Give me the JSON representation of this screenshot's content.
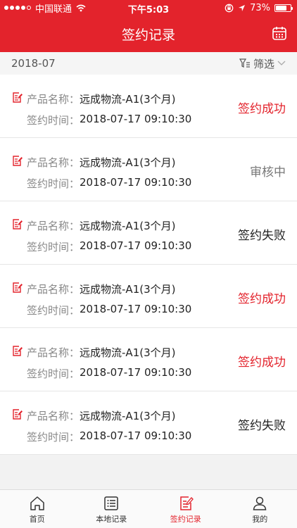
{
  "status_bar": {
    "carrier": "中国联通",
    "time": "下午5:03",
    "battery": "73%",
    "battery_level": 0.73
  },
  "header": {
    "title": "签约记录",
    "calendar_icon": "calendar-icon"
  },
  "filter_bar": {
    "month": "2018-07",
    "filter_label": "筛选"
  },
  "colors": {
    "accent": "#e3232c"
  },
  "records": [
    {
      "name_label": "产品名称：",
      "name": "远成物流-A1(3个月)",
      "time_label": "签约时间：",
      "time": "2018-07-17   09:10:30",
      "status": "签约成功",
      "status_type": "red"
    },
    {
      "name_label": "产品名称：",
      "name": "远成物流-A1(3个月)",
      "time_label": "签约时间：",
      "time": "2018-07-17   09:10:30",
      "status": "审核中",
      "status_type": "gray"
    },
    {
      "name_label": "产品名称：",
      "name": "远成物流-A1(3个月)",
      "time_label": "签约时间：",
      "time": "2018-07-17   09:10:30",
      "status": "签约失败",
      "status_type": "dark"
    },
    {
      "name_label": "产品名称：",
      "name": "远成物流-A1(3个月)",
      "time_label": "签约时间：",
      "time": "2018-07-17   09:10:30",
      "status": "签约成功",
      "status_type": "red"
    },
    {
      "name_label": "产品名称：",
      "name": "远成物流-A1(3个月)",
      "time_label": "签约时间：",
      "time": "2018-07-17   09:10:30",
      "status": "签约成功",
      "status_type": "red"
    },
    {
      "name_label": "产品名称：",
      "name": "远成物流-A1(3个月)",
      "time_label": "签约时间：",
      "time": "2018-07-17   09:10:30",
      "status": "签约失败",
      "status_type": "dark"
    }
  ],
  "tabs": [
    {
      "label": "首页",
      "icon": "home-icon"
    },
    {
      "label": "本地记录",
      "icon": "list-icon"
    },
    {
      "label": "签约记录",
      "icon": "edit-doc-icon",
      "active": true
    },
    {
      "label": "我的",
      "icon": "user-icon"
    }
  ]
}
